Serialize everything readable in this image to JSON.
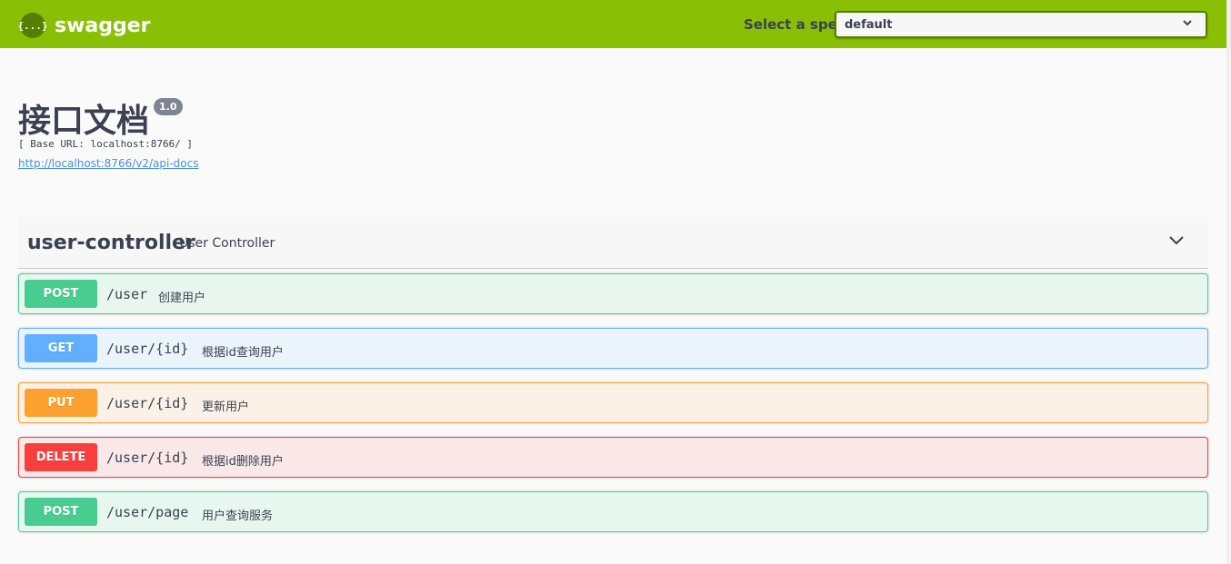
{
  "topbar": {
    "logo_glyph": "{...}",
    "logo_text": "swagger",
    "spec_label": "Select a spec",
    "spec_value": "default"
  },
  "info": {
    "title": "接口文档",
    "version": "1.0",
    "base_url": "[ Base URL: localhost:8766/ ]",
    "docs_link": "http://localhost:8766/v2/api-docs"
  },
  "tag": {
    "name": "user-controller",
    "description": "User Controller"
  },
  "operations": [
    {
      "method": "POST",
      "path": "/user",
      "summary": "创建用户"
    },
    {
      "method": "GET",
      "path": "/user/{id}",
      "summary": "根据id查询用户"
    },
    {
      "method": "PUT",
      "path": "/user/{id}",
      "summary": "更新用户"
    },
    {
      "method": "DELETE",
      "path": "/user/{id}",
      "summary": "根据id删除用户"
    },
    {
      "method": "POST",
      "path": "/user/page",
      "summary": "用户查询服务"
    }
  ],
  "colors": {
    "topbar": "#89bf04",
    "post": "#49cc90",
    "get": "#61affe",
    "put": "#fca130",
    "delete": "#f93e3e"
  }
}
